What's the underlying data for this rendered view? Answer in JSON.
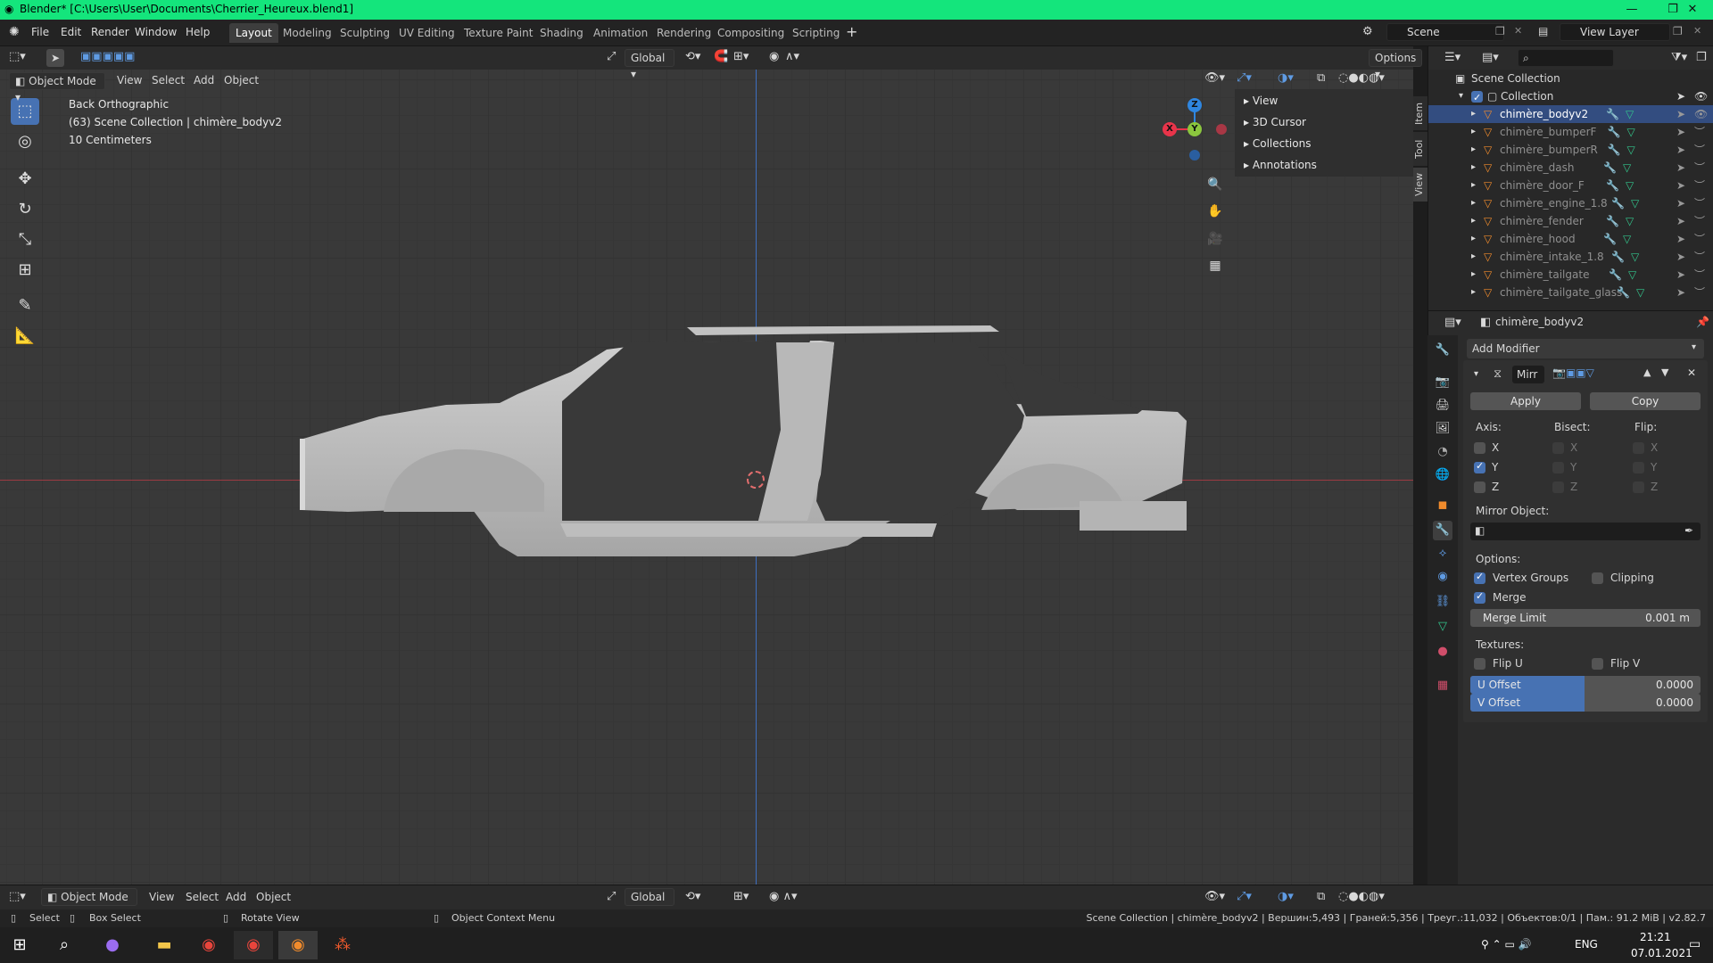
{
  "window": {
    "title": "Blender* [C:\\Users\\User\\Documents\\Cherrier_Heureux.blend1]",
    "minimize": "—",
    "maximize": "❐",
    "close": "✕"
  },
  "menu": [
    "File",
    "Edit",
    "Render",
    "Window",
    "Help"
  ],
  "workspaces": [
    {
      "label": "Layout",
      "active": true
    },
    {
      "label": "Modeling"
    },
    {
      "label": "Sculpting"
    },
    {
      "label": "UV Editing"
    },
    {
      "label": "Texture Paint"
    },
    {
      "label": "Shading"
    },
    {
      "label": "Animation"
    },
    {
      "label": "Rendering"
    },
    {
      "label": "Compositing"
    },
    {
      "label": "Scripting"
    }
  ],
  "add_workspace": "+",
  "scene": {
    "value": "Scene"
  },
  "view_layer": {
    "value": "View Layer"
  },
  "viewport_header": {
    "orientation": "Global",
    "options": "Options",
    "mode": "Object Mode",
    "menus": [
      "View",
      "Select",
      "Add",
      "Object"
    ]
  },
  "viewport": {
    "view_name": "Back Orthographic",
    "collection_info": "(63) Scene Collection | chimère_bodyv2",
    "scale": "10 Centimeters",
    "gizmo": {
      "z": "Z",
      "y": "Y",
      "x": "X"
    }
  },
  "npanel": {
    "items": [
      "View",
      "3D Cursor",
      "Collections",
      "Annotations"
    ],
    "tabs": [
      "Item",
      "Tool",
      "View"
    ]
  },
  "outliner": {
    "root": "Scene Collection",
    "collection": "Collection",
    "items": [
      {
        "name": "chimère_bodyv2",
        "active": true
      },
      {
        "name": "chimère_bumperF"
      },
      {
        "name": "chimère_bumperR"
      },
      {
        "name": "chimère_dash"
      },
      {
        "name": "chimère_door_F"
      },
      {
        "name": "chimère_engine_1.8"
      },
      {
        "name": "chimère_fender"
      },
      {
        "name": "chimère_hood"
      },
      {
        "name": "chimère_intake_1.8"
      },
      {
        "name": "chimère_tailgate"
      },
      {
        "name": "chimère_tailgate_glass"
      }
    ]
  },
  "properties": {
    "object_name": "chimère_bodyv2",
    "add_modifier": "Add Modifier",
    "modifier_name": "Mirr",
    "apply": "Apply",
    "copy": "Copy",
    "axis_label": "Axis:",
    "bisect_label": "Bisect:",
    "flip_label": "Flip:",
    "axes": [
      {
        "label": "X",
        "axis": false,
        "bisect": false,
        "flip": false
      },
      {
        "label": "Y",
        "axis": true,
        "bisect": false,
        "flip": false
      },
      {
        "label": "Z",
        "axis": false,
        "bisect": false,
        "flip": false
      }
    ],
    "mirror_object_label": "Mirror Object:",
    "options_label": "Options:",
    "vertex_groups": {
      "label": "Vertex Groups",
      "checked": true
    },
    "clipping": {
      "label": "Clipping",
      "checked": false
    },
    "merge": {
      "label": "Merge",
      "checked": true
    },
    "merge_limit": {
      "label": "Merge Limit",
      "value": "0.001 m"
    },
    "textures_label": "Textures:",
    "flip_u": {
      "label": "Flip U",
      "checked": false
    },
    "flip_v": {
      "label": "Flip V",
      "checked": false
    },
    "u_offset": {
      "label": "U Offset",
      "value": "0.0000"
    },
    "v_offset": {
      "label": "V Offset",
      "value": "0.0000"
    }
  },
  "bottom_header": {
    "mode": "Object Mode",
    "menus": [
      "View",
      "Select",
      "Add",
      "Object"
    ],
    "orientation": "Global"
  },
  "statusbar": {
    "select": "Select",
    "box_select": "Box Select",
    "rotate_view": "Rotate View",
    "context_menu": "Object Context Menu",
    "stats": "Scene Collection | chimère_bodyv2 | Вершин:5,493 | Граней:5,356 | Треуг.:11,032 | Объектов:0/1 | Пам.: 91.2 MiB | v2.82.7"
  },
  "taskbar": {
    "language": "ENG",
    "time": "21:21",
    "date": "07.01.2021"
  },
  "colors": {
    "accent": "#4772b3",
    "titlebar": "#14e57c",
    "x_axis": "#e8344a",
    "y_axis": "#8bc63e",
    "z_axis": "#2f86e0"
  }
}
